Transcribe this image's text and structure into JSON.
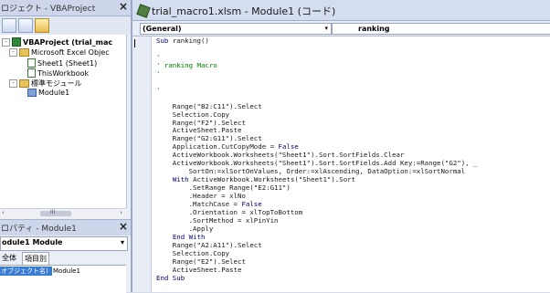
{
  "project_panel": {
    "title": "ロジェクト - VBAProject",
    "close": "×",
    "tree": [
      {
        "label": "VBAProject (trial_mac",
        "icon": "vba-project-icon",
        "bold": true
      },
      {
        "label": "Microsoft Excel Objec",
        "icon": "folder-icon",
        "bold": false
      },
      {
        "label": "Sheet1 (Sheet1)",
        "icon": "sheet-icon",
        "bold": false
      },
      {
        "label": "ThisWorkbook",
        "icon": "workbook-icon",
        "bold": false
      },
      {
        "label": "標準モジュール",
        "icon": "folder-icon",
        "bold": false
      },
      {
        "label": "Module1",
        "icon": "module-icon",
        "bold": false
      }
    ],
    "scroll_glyph": "III"
  },
  "properties_panel": {
    "title": "ロパティ - Module1",
    "close": "×",
    "object_combo": "odule1 Module",
    "tab_all": "全体",
    "tab_category": "項目別",
    "prop_name": "オブジェクト名)",
    "prop_value": "Module1"
  },
  "code_window": {
    "title": "trial_macro1.xlsm - Module1 (コード)",
    "object_combo": "(General)",
    "proc_combo": "ranking",
    "code_lines": [
      [
        [
          "Sub",
          "kw"
        ],
        [
          " ranking()",
          ""
        ]
      ],
      [
        [
          "",
          ""
        ]
      ],
      [
        [
          "'",
          "cm"
        ]
      ],
      [
        [
          "' ranking Macro",
          "cm"
        ]
      ],
      [
        [
          "'",
          "cm"
        ]
      ],
      [
        [
          "",
          ""
        ]
      ],
      [
        [
          "'",
          "cm"
        ]
      ],
      [
        [
          "",
          ""
        ]
      ],
      [
        [
          "    Range(\"B2:C11\").Select",
          ""
        ]
      ],
      [
        [
          "    Selection.Copy",
          ""
        ]
      ],
      [
        [
          "    Range(\"F2\").Select",
          ""
        ]
      ],
      [
        [
          "    ActiveSheet.Paste",
          ""
        ]
      ],
      [
        [
          "    Range(\"G2:G11\").Select",
          ""
        ]
      ],
      [
        [
          "    Application.CutCopyMode = ",
          ""
        ],
        [
          "False",
          "kw"
        ]
      ],
      [
        [
          "    ActiveWorkbook.Worksheets(\"Sheet1\").Sort.SortFields.Clear",
          ""
        ]
      ],
      [
        [
          "    ActiveWorkbook.Worksheets(\"Sheet1\").Sort.SortFields.Add Key:=Range(\"G2\"), _",
          ""
        ]
      ],
      [
        [
          "        SortOn:=xlSortOnValues, Order:=xlAscending, DataOption:=xlSortNormal",
          ""
        ]
      ],
      [
        [
          "    ",
          ""
        ],
        [
          "With",
          "kw"
        ],
        [
          " ActiveWorkbook.Worksheets(\"Sheet1\").Sort",
          ""
        ]
      ],
      [
        [
          "        .SetRange Range(\"E2:G11\")",
          ""
        ]
      ],
      [
        [
          "        .Header = xlNo",
          ""
        ]
      ],
      [
        [
          "        .MatchCase = ",
          ""
        ],
        [
          "False",
          "kw"
        ]
      ],
      [
        [
          "        .Orientation = xlTopToBottom",
          ""
        ]
      ],
      [
        [
          "        .SortMethod = xlPinYin",
          ""
        ]
      ],
      [
        [
          "        .Apply",
          ""
        ]
      ],
      [
        [
          "    ",
          ""
        ],
        [
          "End With",
          "kw"
        ]
      ],
      [
        [
          "    Range(\"A2:A11\").Select",
          ""
        ]
      ],
      [
        [
          "    Selection.Copy",
          ""
        ]
      ],
      [
        [
          "    Range(\"E2\").Select",
          ""
        ]
      ],
      [
        [
          "    ActiveSheet.Paste",
          ""
        ]
      ],
      [
        [
          "End Sub",
          "kw"
        ]
      ]
    ]
  }
}
